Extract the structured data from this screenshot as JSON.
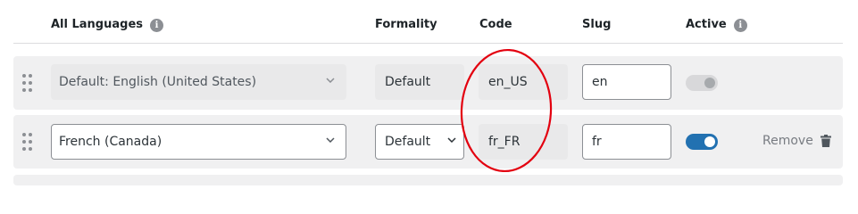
{
  "headers": {
    "languages": "All Languages",
    "formality": "Formality",
    "code": "Code",
    "slug": "Slug",
    "active": "Active"
  },
  "info_glyph": "i",
  "rows": [
    {
      "language": "Default: English (United States)",
      "formality": "Default",
      "code": "en_US",
      "slug": "en",
      "active": false
    },
    {
      "language": "French (Canada)",
      "formality": "Default",
      "code": "fr_FR",
      "slug": "fr",
      "active": true,
      "remove_label": "Remove"
    }
  ],
  "colors": {
    "toggle_on": "#2271b1",
    "annotation_circle": "#e3000f"
  }
}
